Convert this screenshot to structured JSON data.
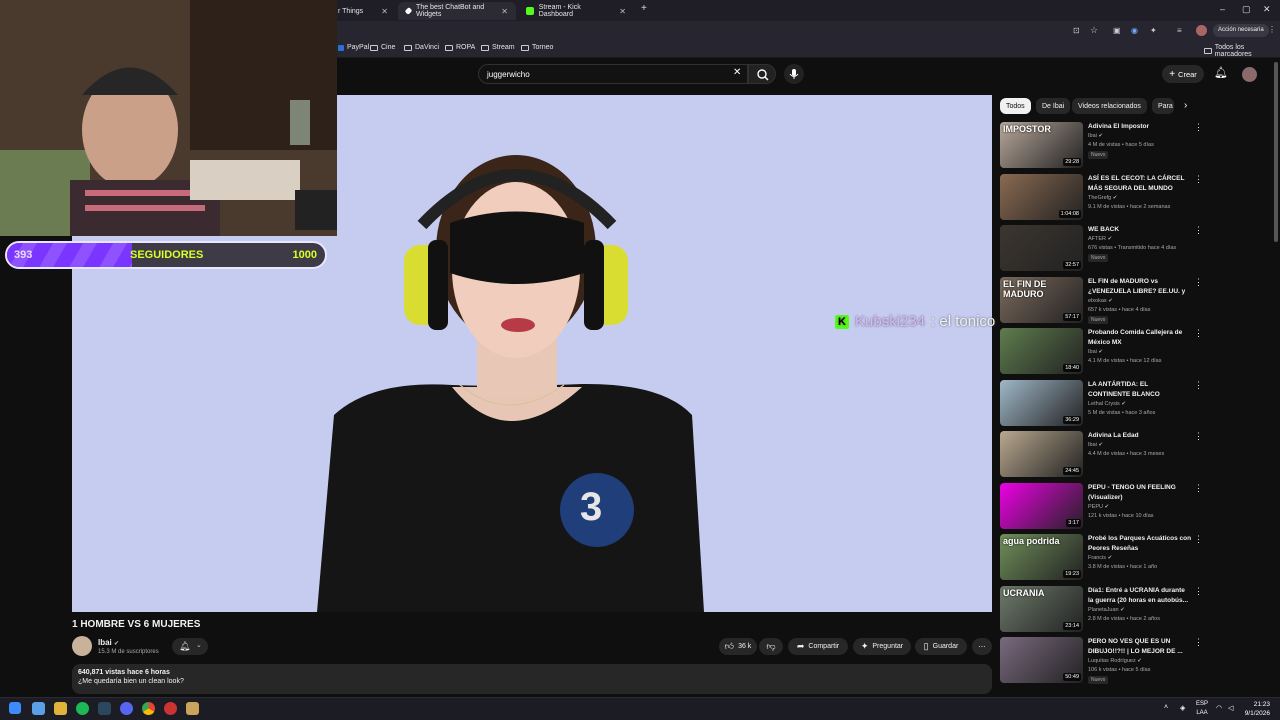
{
  "browser": {
    "tabs": [
      {
        "label": "r Things"
      },
      {
        "label": "The best ChatBot and Widgets"
      },
      {
        "label": "Stream - Kick Dashboard"
      }
    ],
    "new_tab": "+",
    "profile_label": "Acción necesaria",
    "bookmarks": [
      "PayPal",
      "Cine",
      "DaVinci",
      "ROPA",
      "Stream",
      "Torneo"
    ],
    "all_bookmarks": "Todos los marcadores"
  },
  "youtube": {
    "search_value": "juggerwicho",
    "create_label": "Crear"
  },
  "overlay": {
    "chat_user": "Kubski234",
    "chat_message": ": el tonico",
    "followers_current": "393",
    "followers_label": "SEGUIDORES",
    "followers_goal": "1000",
    "followers_progress": 0.393
  },
  "video": {
    "title": "1 HOMBRE VS 6 MUJERES",
    "channel": "Ibai",
    "subscribers": "15.3 M de suscriptores",
    "likes": "36 k",
    "share": "Compartir",
    "ask": "Preguntar",
    "save": "Guardar",
    "views_time": "640,871 vistas  hace 6 horas",
    "description": "¿Me quedaría bien un clean look?",
    "jersey_number": "3"
  },
  "sidebar": {
    "chips": [
      "Todos",
      "De Ibai",
      "Videos relacionados",
      "Para"
    ],
    "recommendations": [
      {
        "title": "Adivina El Impostor",
        "channel": "Ibai",
        "meta": "4 M de vistas • hace 5 días",
        "duration": "29:28",
        "badge": "Nuevo",
        "thumb_text": "IMPOSTOR",
        "color": "#b7a79a"
      },
      {
        "title": "ASÍ ES EL CECOT: LA CÁRCEL MÁS SEGURA DEL MUNDO",
        "channel": "TheGrefg",
        "meta": "9.1 M de vistas • hace 2 semanas",
        "duration": "1:04:08",
        "badge": "",
        "thumb_text": "",
        "color": "#8a6a52"
      },
      {
        "title": "WE BACK",
        "channel": "AFTER",
        "meta": "676 vistas • Transmitido hace 4 días",
        "duration": "32:57",
        "badge": "Nuevo",
        "thumb_text": "",
        "color": "#3c3630"
      },
      {
        "title": "EL FIN de MADURO vs ¿VENEZUELA LIBRE? EE.UU. y ...",
        "channel": "elxokas",
        "meta": "657 k vistas • hace 4 días",
        "duration": "57:17",
        "badge": "Nuevo",
        "thumb_text": "EL FIN DE MADURO",
        "color": "#7b6a5c"
      },
      {
        "title": "Probando Comida Callejera de México MX",
        "channel": "Ibai",
        "meta": "4.1 M de vistas • hace 12 días",
        "duration": "18:40",
        "badge": "",
        "thumb_text": "",
        "color": "#5f7d4e"
      },
      {
        "title": "LA ANTÁRTIDA: EL CONTINENTE BLANCO",
        "channel": "Lethal Crysis",
        "meta": "5 M de vistas • hace 3 años",
        "duration": "36:29",
        "badge": "",
        "thumb_text": "",
        "color": "#9fb8c8"
      },
      {
        "title": "Adivina La Edad",
        "channel": "Ibai",
        "meta": "4.4 M de vistas • hace 3 meses",
        "duration": "24:45",
        "badge": "",
        "thumb_text": "",
        "color": "#b9a88f"
      },
      {
        "title": "PEPU - TENGO UN FEELING (Visualizer)",
        "channel": "PEPU",
        "meta": "121 k vistas • hace 10 días",
        "duration": "3:17",
        "badge": "",
        "thumb_text": "",
        "color": "#ee00e6"
      },
      {
        "title": "Probé los Parques Acuáticos con Peores Reseñas",
        "channel": "Francis",
        "meta": "3.8 M de vistas • hace 1 año",
        "duration": "19:23",
        "badge": "",
        "thumb_text": "agua podrida",
        "color": "#6f8f5a"
      },
      {
        "title": "Día1: Entré a UCRANIA durante la guerra (20 horas en autobús...",
        "channel": "PlanetaJuan",
        "meta": "2.8 M de vistas • hace 2 años",
        "duration": "23:14",
        "badge": "",
        "thumb_text": "UCRANIA",
        "color": "#6d7a6a"
      },
      {
        "title": "PERO NO VES QUE ES UN DIBUJO!!?!! | LO MEJOR DE ...",
        "channel": "Luquitas Rodríguez",
        "meta": "106 k vistas • hace 5 días",
        "duration": "50:49",
        "badge": "Nuevo",
        "thumb_text": "",
        "color": "#7a6a7f"
      }
    ]
  },
  "taskbar": {
    "lang_top": "ESP",
    "lang_bottom": "LAA",
    "time": "21:23",
    "date": "9/1/2026"
  }
}
